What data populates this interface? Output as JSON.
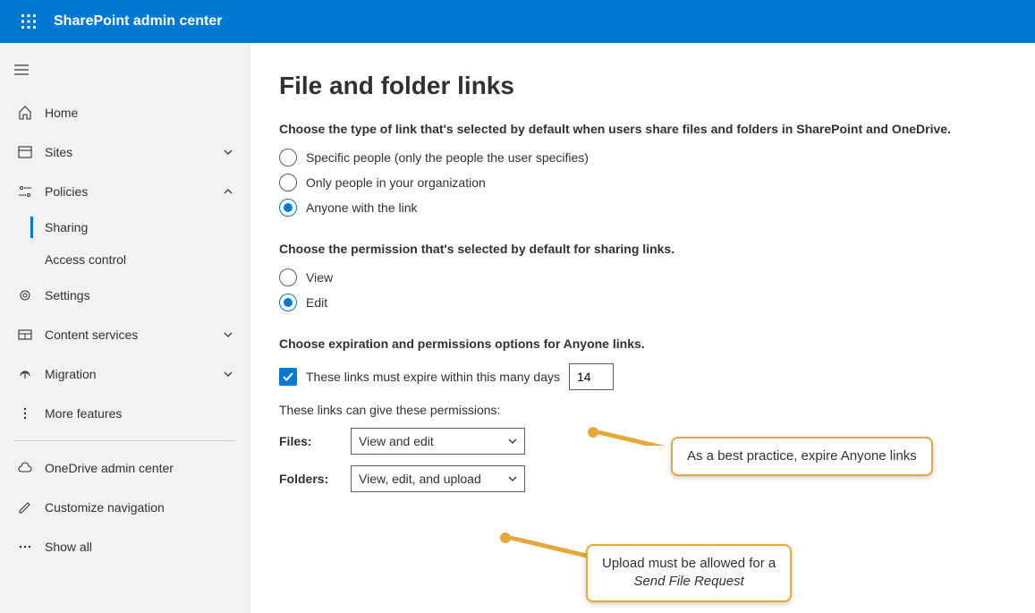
{
  "header": {
    "app_title": "SharePoint admin center"
  },
  "sidebar": {
    "items": [
      {
        "label": "Home"
      },
      {
        "label": "Sites"
      },
      {
        "label": "Policies"
      },
      {
        "label": "Sharing"
      },
      {
        "label": "Access control"
      },
      {
        "label": "Settings"
      },
      {
        "label": "Content services"
      },
      {
        "label": "Migration"
      },
      {
        "label": "More features"
      },
      {
        "label": "OneDrive admin center"
      },
      {
        "label": "Customize navigation"
      },
      {
        "label": "Show all"
      }
    ]
  },
  "main": {
    "title": "File and folder links",
    "linktype": {
      "heading": "Choose the type of link that's selected by default when users share files and folders in SharePoint and OneDrive.",
      "options": [
        "Specific people (only the people the user specifies)",
        "Only people in your organization",
        "Anyone with the link"
      ],
      "selected": 2
    },
    "permission": {
      "heading": "Choose the permission that's selected by default for sharing links.",
      "options": [
        "View",
        "Edit"
      ],
      "selected": 1
    },
    "anyone": {
      "heading": "Choose expiration and permissions options for Anyone links.",
      "expire_label": "These links must expire within this many days",
      "expire_value": "14",
      "perm_label": "These links can give these permissions:",
      "files_label": "Files:",
      "files_value": "View and edit",
      "folders_label": "Folders:",
      "folders_value": "View, edit, and upload"
    },
    "callouts": {
      "c1": "As a best practice, expire Anyone links",
      "c2_a": "Upload must be allowed for a",
      "c2_b": "Send File Request"
    }
  }
}
